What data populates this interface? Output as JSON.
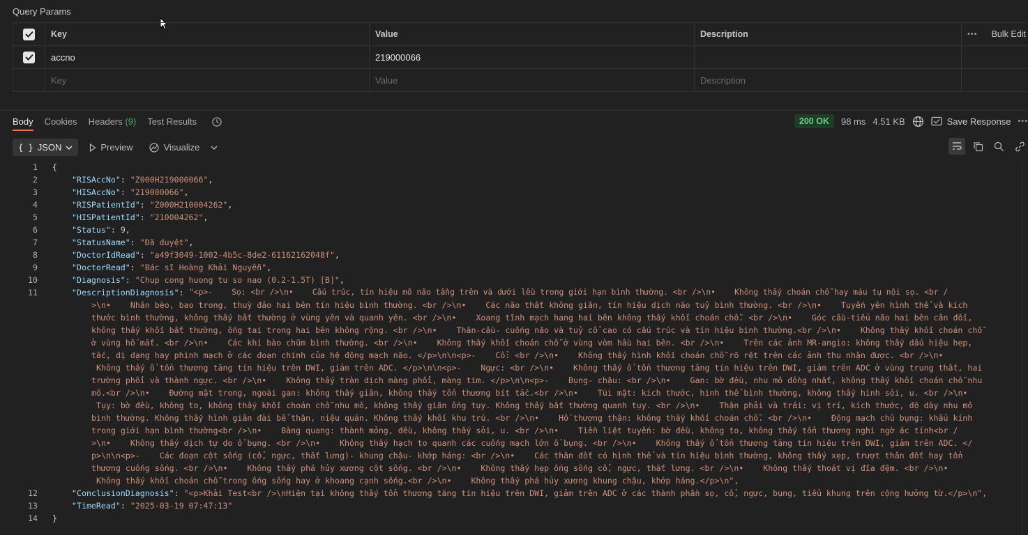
{
  "query_params": {
    "title": "Query Params",
    "headers": {
      "key": "Key",
      "value": "Value",
      "description": "Description",
      "bulk_edit": "Bulk Edit"
    },
    "rows": [
      {
        "key": "accno",
        "value": "219000066",
        "description": ""
      }
    ],
    "placeholder": {
      "key": "Key",
      "value": "Value",
      "description": "Description"
    }
  },
  "response": {
    "tabs": {
      "body": "Body",
      "cookies": "Cookies",
      "headers": "Headers",
      "headers_count": "(9)",
      "test_results": "Test Results"
    },
    "status": "200 OK",
    "time": "98 ms",
    "size": "4.51 KB",
    "save_response": "Save Response",
    "toolbar": {
      "format": "JSON",
      "preview": "Preview",
      "visualize": "Visualize"
    }
  },
  "code": {
    "line_numbers": [
      "1",
      "2",
      "3",
      "4",
      "5",
      "6",
      "7",
      "8",
      "9",
      "10",
      "11",
      "12",
      "13",
      "14"
    ],
    "open_brace": "{",
    "close_brace": "}",
    "fields": [
      {
        "key": "\"RISAccNo\"",
        "value": "\"Z000H219000066\"",
        "type": "s"
      },
      {
        "key": "\"HISAccNo\"",
        "value": "\"219000066\"",
        "type": "s"
      },
      {
        "key": "\"RISPatientId\"",
        "value": "\"Z000H210004262\"",
        "type": "s"
      },
      {
        "key": "\"HISPatientId\"",
        "value": "\"210004262\"",
        "type": "s"
      },
      {
        "key": "\"Status\"",
        "value": "9",
        "type": "n"
      },
      {
        "key": "\"StatusName\"",
        "value": "\"Đã duyệt\"",
        "type": "s"
      },
      {
        "key": "\"DoctorIdRead\"",
        "value": "\"a49f3049-1002-4b5c-8de2-61162162048f\"",
        "type": "s"
      },
      {
        "key": "\"DoctorRead\"",
        "value": "\"Bác sĩ Hoàng Khải Nguyễn\"",
        "type": "s"
      },
      {
        "key": "\"Diagnosis\"",
        "value": "\"Chup cong huong tu so nao (0.2-1.5T) [B]\"",
        "type": "s"
      }
    ],
    "description_key": "\"DescriptionDiagnosis\"",
    "description_lines": [
      "\"<p>-    Sọ: <br />\\n•    Cấu trúc, tín hiệu mô não tầng trên và dưới lều trong giới hạn bình thường. <br />\\n•    Không thấy choán chỗ hay máu tụ nội sọ. <br /",
      ">\\n•    Nhân bèo, bao trong, thuỳ đảo hai bên tín hiệu bình thường. <br />\\n•    Các não thất không giãn, tín hiệu dịch não tuỷ bình thường. <br />\\n•    Tuyến yên hình thể và kích",
      "thước bình thường, không thấy bất thường ở vùng yên và quanh yên. <br />\\n•    Xoang tĩnh mạch hang hai bên không thấy khối choán chỗ. <br />\\n•    Góc cầu-tiểu não hai bên cân đối,",
      "không thấy khối bất thường, ống tai trong hai bên không rộng. <br />\\n•    Thân-cầu- cuống não và tuỷ cổ cao có cấu trúc và tín hiệu bình thường.<br />\\n•    Không thấy khối choán chỗ",
      "ở vùng hố mắt. <br />\\n•    Các khi bào chũm bình thường. <br />\\n•    Không thấy khối choán chỗ ở vùng vòm hầu hai bên. <br />\\n•    Trên các ảnh MR-angio: không thấy dấu hiệu hẹp,",
      "tắc, dị dạng hay phình mạch ở các đoạn chính của hệ động mạch não. </p>\\n\\n<p>-    Cổ: <br />\\n•    Không thấy hình khối choán chỗ rõ rệt trên các ảnh thu nhận được. <br />\\n•",
      " Không thấy ổ tổn thương tăng tín hiệu trên DWI, giảm trên ADC. </p>\\n\\n<p>-    Ngực: <br />\\n•    Không thấy ổ tổn thương tăng tín hiệu trên DWI, giảm trên ADC ở vùng trung thất, hai",
      "trường phổi và thành ngực. <br />\\n•    Không thấy tràn dịch màng phổi, màng tim. </p>\\n\\n<p>-    Bụng- chậu: <br />\\n•    Gan: bờ đều, nhu mô đồng nhất, không thấy khối choán chỗ nhu",
      "mô.<br />\\n•    Đường mật trong, ngoài gan: không thấy giãn, không thấy tổn thương bít tắc.<br />\\n•    Túi mật: kích thước, hình thể bình thường, không thấy hình sỏi, u. <br />\\n•",
      " Tụy: bờ đều, không to, không thấy khối choán chỗ nhu mô, không thấy giãn ống tụy. Không thấy bất thường quanh tụy. <br />\\n•    Thận phải và trái: vị trí, kích thước, độ dày nhu mô",
      "bình thường. Không thấy hình giãn đài bể thận, niệu quản. Không thấy khối khu trú. <br />\\n•    Hố thượng thận: không thấy khối choán chỗ. <br />\\n•    Động mạch chủ bụng: khẩu kính",
      "trong giới hạn bình thường<br />\\n•    Bàng quang: thành mỏng, đều, không thấy sỏi, u. <br />\\n•    Tiền liệt tuyến: bờ đều, không to, không thấy tổn thương nghi ngờ ác tính<br /",
      ">\\n•    Không thấy dịch tự do ổ bụng. <br />\\n•    Không thấy hạch to quanh các cuống mạch lớn ổ bụng. <br />\\n•    Không thấy ổ tổn thương tăng tín hiệu trên DWI, giảm trên ADC. </",
      "p>\\n\\n<p>-    Các đoạn cột sống (cổ, ngực, thắt lưng)- khung chậu- khớp háng: <br />\\n•    Các thân đốt có hình thể và tín hiệu bình thường, không thấy xẹp, trượt thân đốt hay tổn",
      "thương cuống sống. <br />\\n•    Không thấy phá hủy xương cột sống. <br />\\n•    Không thấy hẹp ống sống cổ, ngực, thắt lưng. <br />\\n•    Không thấy thoát vị đĩa đệm. <br />\\n•",
      " Không thấy khối choán chỗ trong ống sống hay ở khoang cạnh sống.<br />\\n•    Không thấy phá hủy xương khung chậu, khớp háng.</p>\\n\","
    ],
    "conclusion_key": "\"ConclusionDiagnosis\"",
    "conclusion_value": "\"<p>Khải Test<br />\\nHiện tại không thấy tổn thương tăng tín hiệu trên DWI, giảm trên ADC ở các thành phần sọ, cổ, ngực, bụng, tiểu khung trên cộng hưởng từ.</p>\\n\",",
    "timeread_key": "\"TimeRead\"",
    "timeread_value": "\"2025-03-19 07:47:13\""
  }
}
